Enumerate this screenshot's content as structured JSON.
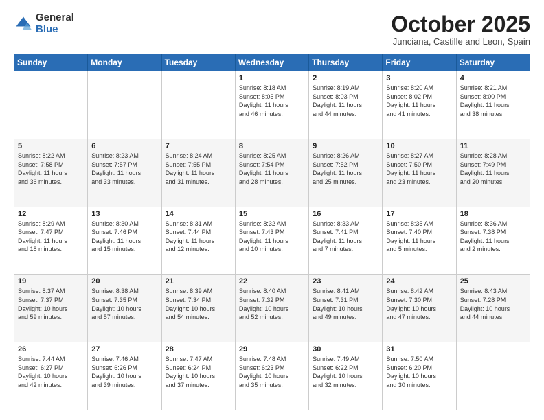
{
  "header": {
    "logo_general": "General",
    "logo_blue": "Blue",
    "title": "October 2025",
    "subtitle": "Junciana, Castille and Leon, Spain"
  },
  "calendar": {
    "days_of_week": [
      "Sunday",
      "Monday",
      "Tuesday",
      "Wednesday",
      "Thursday",
      "Friday",
      "Saturday"
    ],
    "weeks": [
      [
        {
          "day": "",
          "info": ""
        },
        {
          "day": "",
          "info": ""
        },
        {
          "day": "",
          "info": ""
        },
        {
          "day": "1",
          "info": "Sunrise: 8:18 AM\nSunset: 8:05 PM\nDaylight: 11 hours\nand 46 minutes."
        },
        {
          "day": "2",
          "info": "Sunrise: 8:19 AM\nSunset: 8:03 PM\nDaylight: 11 hours\nand 44 minutes."
        },
        {
          "day": "3",
          "info": "Sunrise: 8:20 AM\nSunset: 8:02 PM\nDaylight: 11 hours\nand 41 minutes."
        },
        {
          "day": "4",
          "info": "Sunrise: 8:21 AM\nSunset: 8:00 PM\nDaylight: 11 hours\nand 38 minutes."
        }
      ],
      [
        {
          "day": "5",
          "info": "Sunrise: 8:22 AM\nSunset: 7:58 PM\nDaylight: 11 hours\nand 36 minutes."
        },
        {
          "day": "6",
          "info": "Sunrise: 8:23 AM\nSunset: 7:57 PM\nDaylight: 11 hours\nand 33 minutes."
        },
        {
          "day": "7",
          "info": "Sunrise: 8:24 AM\nSunset: 7:55 PM\nDaylight: 11 hours\nand 31 minutes."
        },
        {
          "day": "8",
          "info": "Sunrise: 8:25 AM\nSunset: 7:54 PM\nDaylight: 11 hours\nand 28 minutes."
        },
        {
          "day": "9",
          "info": "Sunrise: 8:26 AM\nSunset: 7:52 PM\nDaylight: 11 hours\nand 25 minutes."
        },
        {
          "day": "10",
          "info": "Sunrise: 8:27 AM\nSunset: 7:50 PM\nDaylight: 11 hours\nand 23 minutes."
        },
        {
          "day": "11",
          "info": "Sunrise: 8:28 AM\nSunset: 7:49 PM\nDaylight: 11 hours\nand 20 minutes."
        }
      ],
      [
        {
          "day": "12",
          "info": "Sunrise: 8:29 AM\nSunset: 7:47 PM\nDaylight: 11 hours\nand 18 minutes."
        },
        {
          "day": "13",
          "info": "Sunrise: 8:30 AM\nSunset: 7:46 PM\nDaylight: 11 hours\nand 15 minutes."
        },
        {
          "day": "14",
          "info": "Sunrise: 8:31 AM\nSunset: 7:44 PM\nDaylight: 11 hours\nand 12 minutes."
        },
        {
          "day": "15",
          "info": "Sunrise: 8:32 AM\nSunset: 7:43 PM\nDaylight: 11 hours\nand 10 minutes."
        },
        {
          "day": "16",
          "info": "Sunrise: 8:33 AM\nSunset: 7:41 PM\nDaylight: 11 hours\nand 7 minutes."
        },
        {
          "day": "17",
          "info": "Sunrise: 8:35 AM\nSunset: 7:40 PM\nDaylight: 11 hours\nand 5 minutes."
        },
        {
          "day": "18",
          "info": "Sunrise: 8:36 AM\nSunset: 7:38 PM\nDaylight: 11 hours\nand 2 minutes."
        }
      ],
      [
        {
          "day": "19",
          "info": "Sunrise: 8:37 AM\nSunset: 7:37 PM\nDaylight: 10 hours\nand 59 minutes."
        },
        {
          "day": "20",
          "info": "Sunrise: 8:38 AM\nSunset: 7:35 PM\nDaylight: 10 hours\nand 57 minutes."
        },
        {
          "day": "21",
          "info": "Sunrise: 8:39 AM\nSunset: 7:34 PM\nDaylight: 10 hours\nand 54 minutes."
        },
        {
          "day": "22",
          "info": "Sunrise: 8:40 AM\nSunset: 7:32 PM\nDaylight: 10 hours\nand 52 minutes."
        },
        {
          "day": "23",
          "info": "Sunrise: 8:41 AM\nSunset: 7:31 PM\nDaylight: 10 hours\nand 49 minutes."
        },
        {
          "day": "24",
          "info": "Sunrise: 8:42 AM\nSunset: 7:30 PM\nDaylight: 10 hours\nand 47 minutes."
        },
        {
          "day": "25",
          "info": "Sunrise: 8:43 AM\nSunset: 7:28 PM\nDaylight: 10 hours\nand 44 minutes."
        }
      ],
      [
        {
          "day": "26",
          "info": "Sunrise: 7:44 AM\nSunset: 6:27 PM\nDaylight: 10 hours\nand 42 minutes."
        },
        {
          "day": "27",
          "info": "Sunrise: 7:46 AM\nSunset: 6:26 PM\nDaylight: 10 hours\nand 39 minutes."
        },
        {
          "day": "28",
          "info": "Sunrise: 7:47 AM\nSunset: 6:24 PM\nDaylight: 10 hours\nand 37 minutes."
        },
        {
          "day": "29",
          "info": "Sunrise: 7:48 AM\nSunset: 6:23 PM\nDaylight: 10 hours\nand 35 minutes."
        },
        {
          "day": "30",
          "info": "Sunrise: 7:49 AM\nSunset: 6:22 PM\nDaylight: 10 hours\nand 32 minutes."
        },
        {
          "day": "31",
          "info": "Sunrise: 7:50 AM\nSunset: 6:20 PM\nDaylight: 10 hours\nand 30 minutes."
        },
        {
          "day": "",
          "info": ""
        }
      ]
    ]
  }
}
